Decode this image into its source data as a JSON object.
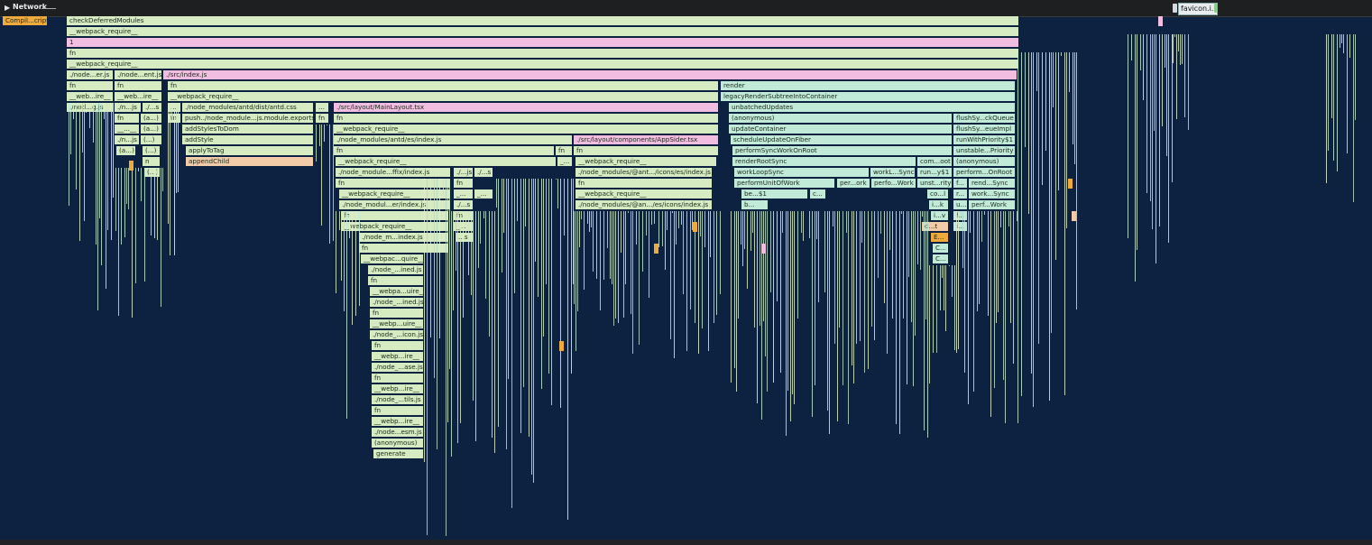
{
  "network": {
    "label": "Network",
    "request_label": "favicon.i..."
  },
  "colors": {
    "background": "#0d2241",
    "green": "#d6ebc2",
    "mint": "#bfe8cc",
    "pink": "#f1bde0",
    "orange": "#f2cca9",
    "yellow": "#f0a93b"
  },
  "frames": [
    {
      "text": "Compil...cript",
      "c": "y"
    },
    {
      "text": "checkDeferredModules",
      "c": "g"
    },
    {
      "text": "__webpack_require__",
      "c": "g"
    },
    {
      "text": "1",
      "c": "p"
    },
    {
      "text": "fn",
      "c": "g"
    },
    {
      "text": "__webpack_require__",
      "c": "g"
    },
    {
      "text": "./node...er.js",
      "c": "g"
    },
    {
      "text": "./node...ent.js",
      "c": "g"
    },
    {
      "text": "./src/index.js",
      "c": "p"
    },
    {
      "text": "fn",
      "c": "g"
    },
    {
      "text": "fn",
      "c": "g"
    },
    {
      "text": "fn",
      "c": "g"
    },
    {
      "text": "render",
      "c": "t"
    },
    {
      "text": "__web...ire__",
      "c": "g"
    },
    {
      "text": "__web...ire__",
      "c": "g"
    },
    {
      "text": "__webpack_require__",
      "c": "g"
    },
    {
      "text": "legacyRenderSubtreeIntoContainer",
      "c": "t"
    },
    {
      "text": "./nod...g.js",
      "c": "g"
    },
    {
      "text": "./n...js",
      "c": "g"
    },
    {
      "text": "./...s",
      "c": "g"
    },
    {
      "text": "...",
      "c": "g"
    },
    {
      "text": "./node_modules/antd/dist/antd.css",
      "c": "g"
    },
    {
      "text": "...",
      "c": "g"
    },
    {
      "text": "./src/layout/MainLayout.tsx",
      "c": "p"
    },
    {
      "text": "unbatchedUpdates",
      "c": "t"
    },
    {
      "text": "fn",
      "c": "g"
    },
    {
      "text": "(a...)",
      "c": "g"
    },
    {
      "text": "fn",
      "c": "g"
    },
    {
      "text": "push../node_module...js.module.exports",
      "c": "g"
    },
    {
      "text": "fn",
      "c": "g"
    },
    {
      "text": "fn",
      "c": "g"
    },
    {
      "text": "(anonymous)",
      "c": "t"
    },
    {
      "text": "flushSy...ckQueue",
      "c": "t"
    },
    {
      "text": "__...__",
      "c": "g"
    },
    {
      "text": "(a...)",
      "c": "g"
    },
    {
      "text": "addStylesToDom",
      "c": "g"
    },
    {
      "text": "__webpack_require__",
      "c": "g"
    },
    {
      "text": "updateContainer",
      "c": "t"
    },
    {
      "text": "flushSy...eueImpl",
      "c": "t"
    },
    {
      "text": "./n...js",
      "c": "g"
    },
    {
      "text": "(...)",
      "c": "g"
    },
    {
      "text": "addStyle",
      "c": "g"
    },
    {
      "text": "./node_modules/antd/es/index.js",
      "c": "g"
    },
    {
      "text": "./src/layout/components/AppSider.tsx",
      "c": "p"
    },
    {
      "text": "scheduleUpdateOnFiber",
      "c": "t"
    },
    {
      "text": "runWithPriority$1",
      "c": "t"
    },
    {
      "text": "(a...)",
      "c": "g"
    },
    {
      "text": "(...)",
      "c": "g"
    },
    {
      "text": "applyToTag",
      "c": "g"
    },
    {
      "text": "fn",
      "c": "g"
    },
    {
      "text": "fn",
      "c": "g"
    },
    {
      "text": "fn",
      "c": "g"
    },
    {
      "text": "performSyncWorkOnRoot",
      "c": "t"
    },
    {
      "text": "unstable...Priority",
      "c": "t"
    },
    {
      "text": "n",
      "c": "g"
    },
    {
      "text": "appendChild",
      "c": "o"
    },
    {
      "text": "__webpack_require__",
      "c": "g"
    },
    {
      "text": "_...",
      "c": "g"
    },
    {
      "text": "__webpack_require__",
      "c": "g"
    },
    {
      "text": "renderRootSync",
      "c": "t"
    },
    {
      "text": "com...oot",
      "c": "t"
    },
    {
      "text": "(anonymous)",
      "c": "t"
    },
    {
      "text": "(...)",
      "c": "g"
    },
    {
      "text": "./node_module...ffix/index.js",
      "c": "g"
    },
    {
      "text": "./...js",
      "c": "g"
    },
    {
      "text": "./...s",
      "c": "g"
    },
    {
      "text": "./node_modules/@ant.../icons/es/index.js",
      "c": "g"
    },
    {
      "text": "workLoopSync",
      "c": "t"
    },
    {
      "text": "workL...Sync",
      "c": "t"
    },
    {
      "text": "run...y$1",
      "c": "t"
    },
    {
      "text": "perform...OnRoot",
      "c": "t"
    },
    {
      "text": "fn",
      "c": "g"
    },
    {
      "text": "fn",
      "c": "g"
    },
    {
      "text": "fn",
      "c": "g"
    },
    {
      "text": "performUnitOfWork",
      "c": "t"
    },
    {
      "text": "per...ork",
      "c": "t"
    },
    {
      "text": "perfo...Work",
      "c": "t"
    },
    {
      "text": "unst...rity",
      "c": "t"
    },
    {
      "text": "f...",
      "c": "t"
    },
    {
      "text": "rend...Sync",
      "c": "t"
    },
    {
      "text": "__webpack_require__",
      "c": "g"
    },
    {
      "text": "_...",
      "c": "g"
    },
    {
      "text": "_...",
      "c": "g"
    },
    {
      "text": "__webpack_require__",
      "c": "g"
    },
    {
      "text": "be...$1",
      "c": "t"
    },
    {
      "text": "c...",
      "c": "t"
    },
    {
      "text": "co...l",
      "c": "t"
    },
    {
      "text": "r...",
      "c": "t"
    },
    {
      "text": "work...Sync",
      "c": "t"
    },
    {
      "text": "./node_modul...er/index.js",
      "c": "g"
    },
    {
      "text": "./...s",
      "c": "g"
    },
    {
      "text": "./node_modules/@an.../es/icons/index.js",
      "c": "g"
    },
    {
      "text": "b...",
      "c": "t"
    },
    {
      "text": "i...k",
      "c": "t"
    },
    {
      "text": "u...",
      "c": "t"
    },
    {
      "text": "perf...Work",
      "c": "t"
    },
    {
      "text": "fn",
      "c": "g"
    },
    {
      "text": "fn",
      "c": "g"
    },
    {
      "text": "i...v",
      "c": "t"
    },
    {
      "text": "f...",
      "c": "t"
    },
    {
      "text": "__webpack_require__",
      "c": "g"
    },
    {
      "text": "_...",
      "c": "g"
    },
    {
      "text": "d...t",
      "c": "o"
    },
    {
      "text": "i...",
      "c": "t"
    },
    {
      "text": "./node_m...index.js",
      "c": "g"
    },
    {
      "text": "...s",
      "c": "g"
    },
    {
      "text": "E...",
      "c": "y"
    },
    {
      "text": "fn",
      "c": "g"
    },
    {
      "text": "C...",
      "c": "t"
    },
    {
      "text": "__webpac...quire__",
      "c": "g"
    },
    {
      "text": "C...",
      "c": "t"
    },
    {
      "text": "./node_...ined.js",
      "c": "g"
    },
    {
      "text": "fn",
      "c": "g"
    },
    {
      "text": "__webpa...uire__",
      "c": "g"
    },
    {
      "text": "./node_...ined.js",
      "c": "g"
    },
    {
      "text": "fn",
      "c": "g"
    },
    {
      "text": "__webp...uire__",
      "c": "g"
    },
    {
      "text": "./node_...icon.js",
      "c": "g"
    },
    {
      "text": "fn",
      "c": "g"
    },
    {
      "text": "__webp...ire__",
      "c": "g"
    },
    {
      "text": "./node_...ase.js",
      "c": "g"
    },
    {
      "text": "fn",
      "c": "g"
    },
    {
      "text": "__webp...ire__",
      "c": "g"
    },
    {
      "text": "./node_...tils.js",
      "c": "g"
    },
    {
      "text": "fn",
      "c": "g"
    },
    {
      "text": "__webp...ire__",
      "c": "g"
    },
    {
      "text": "./node...esm.js",
      "c": "g"
    },
    {
      "text": "(anonymous)",
      "c": "g"
    },
    {
      "text": "generate",
      "c": "g"
    }
  ]
}
